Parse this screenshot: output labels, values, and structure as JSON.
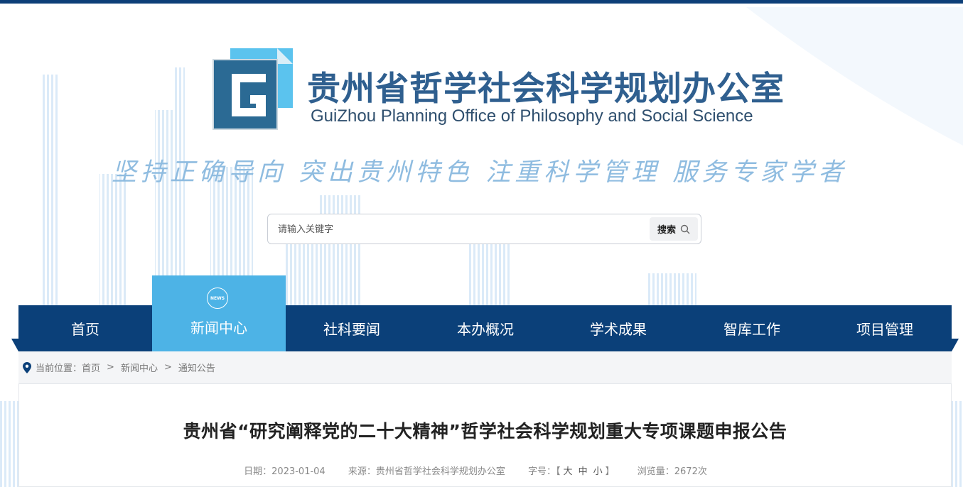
{
  "header": {
    "org_name_cn": "贵州省哲学社会科学规划办公室",
    "org_name_en": "GuiZhou Planning Office of Philosophy and Social Science",
    "slogan": "坚持正确导向 突出贵州特色 注重科学管理 服务专家学者",
    "logo_icon": "gp-logo-icon"
  },
  "search": {
    "placeholder": "请输入关键字",
    "button_label": "搜索"
  },
  "nav": {
    "items": [
      {
        "label": "首页"
      },
      {
        "label": "新闻中心",
        "badge": "NEWS",
        "active": true
      },
      {
        "label": "社科要闻"
      },
      {
        "label": "本办概况"
      },
      {
        "label": "学术成果"
      },
      {
        "label": "智库工作"
      },
      {
        "label": "项目管理"
      }
    ]
  },
  "breadcrumb": {
    "prefix": "当前位置：",
    "items": [
      "首页",
      "新闻中心",
      "通知公告"
    ],
    "separator": ">"
  },
  "article": {
    "title": "贵州省“研究阐释党的二十大精神”哲学社会科学规划重大专项课题申报公告",
    "date": "日期：2023-01-04",
    "source": "来源：贵州省哲学社会科学规划办公室",
    "font_size_label": "字号：",
    "bracket_open": "【",
    "size_large": "大",
    "size_medium": "中",
    "size_small": "小",
    "bracket_close": "】",
    "views": "浏览量：2672次"
  },
  "colors": {
    "brand_blue": "#0b4079",
    "active_blue": "#4db3e6",
    "title_blue": "#2f5f8f",
    "slogan_blue": "#8fbce0"
  }
}
